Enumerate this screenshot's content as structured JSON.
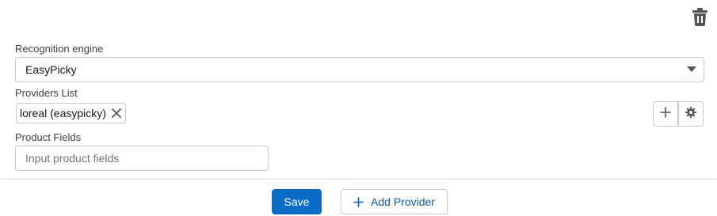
{
  "colors": {
    "primary": "#0b6cc8",
    "link": "#0b5cab",
    "border": "#c9c9c9",
    "label": "#3e3e3c"
  },
  "recognition_engine": {
    "label": "Recognition engine",
    "selected": "EasyPicky",
    "caret_icon": "caret-down-icon"
  },
  "providers": {
    "label": "Providers List",
    "items": [
      {
        "label": "loreal (easypicky)",
        "remove_icon": "close-icon"
      }
    ],
    "add_icon": "plus-icon",
    "settings_icon": "gear-icon"
  },
  "product_fields": {
    "label": "Product Fields",
    "value": "",
    "placeholder": "Input product fields"
  },
  "delete_icon": "trash-icon",
  "footer": {
    "save_label": "Save",
    "add_provider_label": "Add Provider",
    "add_provider_icon": "plus-icon"
  }
}
